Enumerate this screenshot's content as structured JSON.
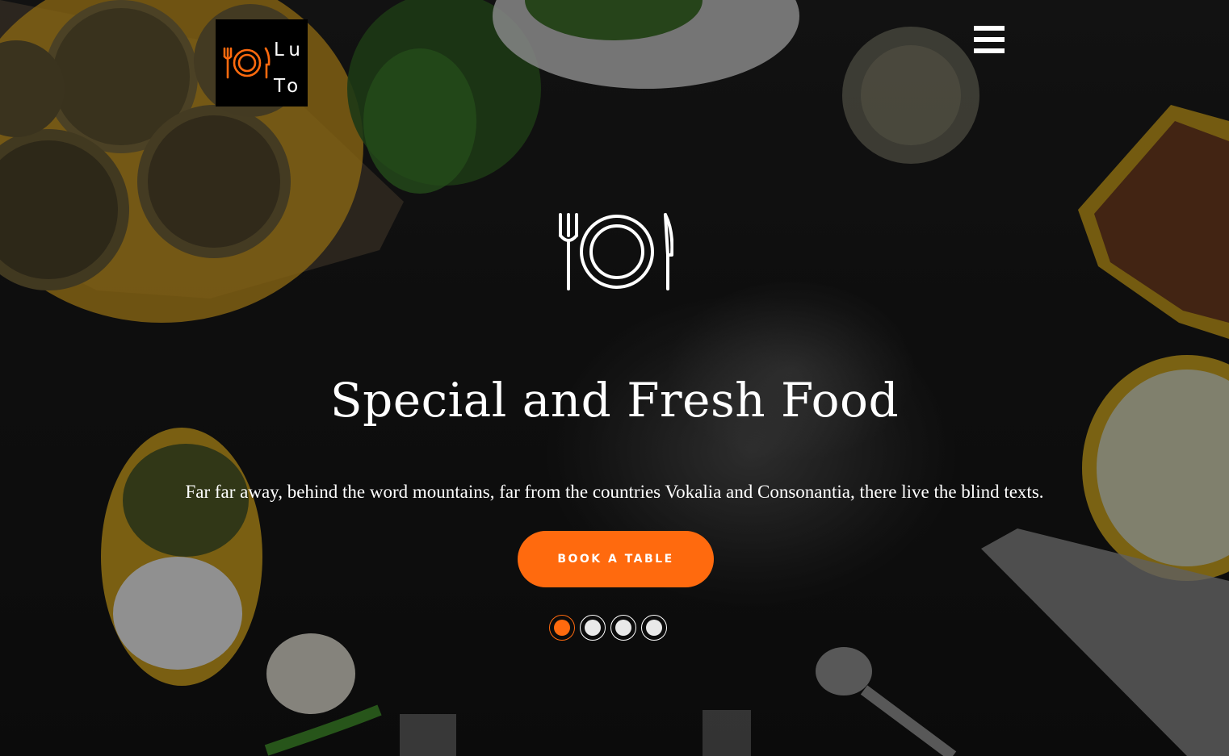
{
  "brand": {
    "line1": "Lu",
    "line2": "To",
    "accent_color": "#ff6a0e"
  },
  "header": {
    "menu_icon": "hamburger-menu-icon"
  },
  "hero": {
    "icon": "fork-plate-knife-icon",
    "title": "Special and Fresh Food",
    "subtitle": "Far far away, behind the word mountains, far from the countries Vokalia and Consonantia, there live the blind texts.",
    "cta_label": "BOOK A TABLE",
    "cta_color": "#ff6a0e"
  },
  "slider": {
    "total_slides": 4,
    "active_index": 0
  }
}
